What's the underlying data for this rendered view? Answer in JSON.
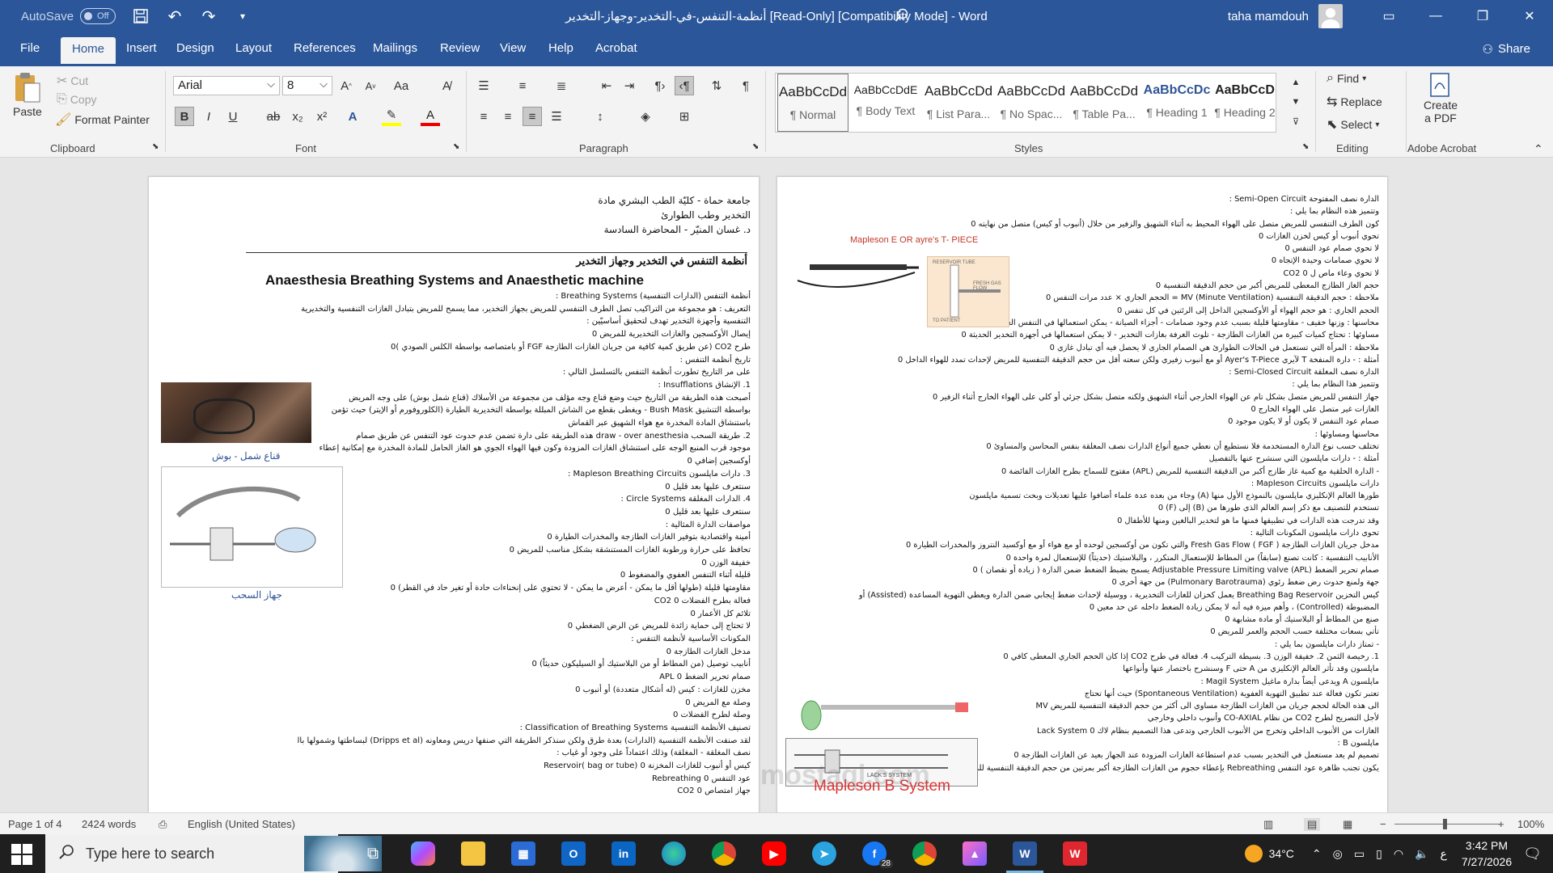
{
  "titlebar": {
    "autosave_label": "AutoSave",
    "autosave_state": "Off",
    "doc_title": "أنظمة-التنفس-في-التخدير-وجهاز-التخدير [Read-Only] [Compatibility Mode]  -  Word",
    "username": "taha mamdouh"
  },
  "tabs": [
    "File",
    "Home",
    "Insert",
    "Design",
    "Layout",
    "References",
    "Mailings",
    "Review",
    "View",
    "Help",
    "Acrobat"
  ],
  "share_label": "Share",
  "clipboard": {
    "paste": "Paste",
    "cut": "Cut",
    "copy": "Copy",
    "format_painter": "Format Painter",
    "group": "Clipboard"
  },
  "font": {
    "name": "Arial",
    "size": "8",
    "group": "Font"
  },
  "paragraph": {
    "group": "Paragraph"
  },
  "styles": {
    "group": "Styles",
    "items": [
      {
        "sample": "AaBbCcDd",
        "name": "¶ Normal"
      },
      {
        "sample": "AaBbCcDdE",
        "name": "¶ Body Text"
      },
      {
        "sample": "AaBbCcDd",
        "name": "¶ List Para..."
      },
      {
        "sample": "AaBbCcDd",
        "name": "¶ No Spac..."
      },
      {
        "sample": "AaBbCcDd",
        "name": "¶ Table Pa..."
      },
      {
        "sample": "AaBbCcDc",
        "name": "¶ Heading 1"
      },
      {
        "sample": "AaBbCcD",
        "name": "¶ Heading 2"
      }
    ]
  },
  "editing": {
    "group": "Editing",
    "find": "Find",
    "replace": "Replace",
    "select": "Select"
  },
  "acrobat": {
    "group": "Adobe Acrobat",
    "create": "Create",
    "pdf": "a PDF"
  },
  "left_page": {
    "header_lines": [
      "جامعة حماة - كليّة الطب البشري مادة",
      "التخدير وطب الطوارئ",
      "د. غسان المنيّر - المحاضرة السادسة"
    ],
    "title_ar": "أنظمة التنفس في التخدير وجهاز التخدير",
    "title_en": "Anaesthesia Breathing Systems and Anaesthetic machine",
    "body": [
      "أنظمة التنفس (الدارات التنفسية) Breathing Systems :",
      "التعريف : هو مجموعة من التراكيب تصل الطرف التنفسي للمريض بجهاز التخدير، مما يسمح للمريض بتبادل الغازات التنفسية والتخديرية من والى جهاز التخدير الهدف : جميع أنواع الدارات",
      "التنفسية وأجهزة التخدير تهدف لتحقيق أساسيّين :",
      "إيصال الأوكسجين والغازات التخديرية للمريض 0",
      "طرح CO2 (عن طريق كمية كافية من جريان الغازات الطازجة FGF أو بامتصاصه بواسطة الكلس الصودي )0",
      "تاريخ أنظمة التنفس :",
      "على مر التاريخ تطورت أنظمة التنفس بالتسلسل التالي :",
      "1. الإنشاق Insufflations :",
      "أصبحت هذه الطريقة من التاريخ حيث وضع قناع وجه مؤلف من مجموعة من الأسلاك (قناع شمل بوش) على وجه المريض",
      "بواسطة التنشيق Bush Mask - ويغطى بقطع من الشاش المبللة بواسطة التخديرية الطيارة (الكلوروفورم أو الإيتر) حيث تؤمن",
      "باستنشاق المادة المخدرة مع هواء الشهيق عبر القماش",
      "2. طريقة السحب draw - over anesthesia هذه الطريقة على دارة تضمن عدم حدوث عود التنفس عن طريق صمام",
      "موجود قرب المنبع الوجه على استنشاق الغازات المزودة وكون فيها الهواء الجوي هو الغاز الحامل للمادة المخدرة مع إمكانية إعطاء",
      "أوكسجين إضافي 0",
      "3. دارات ماپلسون Mapleson Breathing Circuits :",
      "سنتعرف عليها بعد قليل 0",
      "4. الدارات المغلقة Circle Systems :",
      "سنتعرف عليها بعد قليل 0",
      "مواصفات الدارة المثالية :",
      "أمينة واقتصادية بتوفير الغازات الطازجة والمخدرات الطيارة 0",
      "تحافظ على حرارة ورطوبة الغازات المستنشقة بشكل مناسب للمريض 0",
      "خفيفة الوزن 0",
      "قليلة أثناء التنفس العفوي والمضغوط 0",
      "مقاومتها قليلة (طولها أقل ما يمكن - أعرض ما يمكن - لا تحتوي على إنحناءات حادة أو تغير حاد في القطر) 0",
      "فعالة بطرح الفضلات CO2 0",
      "تلائم كل الأعمار 0",
      "لا تحتاج إلى حماية زائدة للمريض عن الرض الضغطي 0",
      "المكونات الأساسية لأنظمة التنفس :",
      "مدخل الغازات الطازجة 0",
      "أنابيب توصيل (من المطاط أو من البلاستيك أو السيليكون حديثاً) 0",
      "صمام تحرير الضغط APL 0",
      "مخزن للغازات : كيس (له أشكال متعددة) أو أنبوب 0",
      "وصلة مع المريض 0",
      "وصلة لطرح الفضلات 0",
      "تصنيف الأنظمة التنفسية Classification of Breathing Systems :",
      "لقد صنفت الأنظمة التنفسية (الدارات) بعدة طرق ولكن سنذكر الطريقة التي صنفها دريس ومعاونه (Dripps et al) لبساطتها وشمولها بالشكل التالي : (المفتوحة - نصف المفتوحة -",
      "نصف المغلقة - المغلقة) وذلك اعتماداً على وجود أو غياب :",
      "كيس أو أنبوب للغازات المخزنة Reservoir( bag or tube) 0",
      "عود التنفس Rebreathing 0",
      "جهاز امتصاص CO2 0"
    ],
    "caption_mask": "قناع شمل - بوش",
    "caption_draw": "جهاز السحب"
  },
  "right_page": {
    "body": [
      "الدارة نصف المفتوحة Semi-Open Circuit :",
      "وتتميز هذه النظام بما يلي :",
      "كون الطرف التنفسي للمريض متصل على الهواء المحيط به أثناء الشهيق والزفير من خلال (أنبوب أو كيس) متصل من نهايته 0",
      "تحوي أنبوب أو كيس لخزن الغازات 0",
      "لا تحوي صمام عود التنفس 0",
      "لا تحوي صمامات وحيدة الإتجاه 0",
      "لا تحوي وعاء ماص ل CO2 0",
      "حجم الغاز الطازج المعطى للمريض أكبر من حجم الدقيقة التنفسية 0",
      "ملاحظة : حجم الدقيقة التنفسية MV (Minute Ventilation) = الحجم الجاري × عدد مرات التنفس 0",
      "الحجم الجاري : هو حجم الهواء أو الأوكسجين الداخل إلى الرئتين في كل تنفس 0",
      "محاسنها : وزنها خفيف - مقاومتها قليلة بسبب عدم وجود صمامات - أجزاء الصيانة - يمكن استعمالها في التنفس العفوي والمضغوط 0",
      "مساوئها : تحتاج كميات كبيرة من الغازات الطازجة - تلوث الغرفة بغازات التخدير - لا يمكن استعمالها في أجهزة التخدير الحديثة 0",
      "ملاحظة : المرأة التي تستعمل في الحالات الطوارئ هي الصمام الجاري لا يحصل فيه أي تبادل غازي 0",
      "أمثلة : - دارة المنفخة T لآيري Ayer's T-Piece أو مع أنبوب زفيري ولكن سعته أقل من حجم الدقيقة التنفسية للمريض لإحداث تمدد للهواء الداخل 0",
      "الدارة نصف المغلقة Semi-Closed Circuit :",
      "وتتميز هذا النظام بما يلي :",
      "جهاز التنفس للمريض متصل بشكل تام عن الهواء الخارجي أثناء الشهيق ولكنه متصل بشكل جزئي أو كلي على الهواء الخارج أثناء الزفير 0",
      "الغازات غير متصل على الهواء الخارج 0",
      "صمام عود التنفس لا يكون أو لا يكون موجود 0",
      "محاسنها ومساوئها :",
      "تختلف حسب نوع الدارة المستخدمة فلا نستطيع أن نعطي جميع أنواع الدارات نصف المغلقة بنفس المحاسن والمساوئ 0",
      "أمثلة : - دارات ماپلسون التي سنشرح عنها بالتفصيل",
      "- الدارة الحلقية مع كمية غاز طازج أكبر من الدقيقة التنفسية للمريض (APL) مفتوح للسماح بطرح الغازات الفائضة 0",
      "دارات ماپلسون Mapleson Circuits :",
      "طورها العالم الإنكليزي ماپلسون بالنموذج الأول منها (A) وجاء من بعده عدة علماء أضافوا عليها تعديلات وبحث تسمية ماپلسون",
      "تستخدم للتصنيف مع ذكر إسم العالم الذي طورها من (B) إلى (F) 0",
      "وقد تدرجت هذه الدارات في تطبيقها فمنها ما هو لتخدير البالغين ومنها للأطفال 0",
      "تحوي دارات ماپلسون المكونات التالية :",
      "مدخل جريان الغازات الطازجة Fresh Gas Flow ( FGF ) والتي تكون من أوكسجين لوحده أو مع هواء أو مع أوكسيد النتروز والمخدرات الطيارة 0",
      "الأنابيب التنفسية : كانت تصنع (سابقاً) من المطاط للإستعمال المتكرر ، والبلاستيك (حديثاً) للإستعمال لمرة واحدة 0",
      "صمام تحرير الضغط Adjustable Pressure Limiting valve (APL) يسمح بضبط الضغط ضمن الدارة ( زيادة أو نقصان ) 0",
      "جهة ولمنع حدوث رض ضغط رئوي (Pulmonary Barotrauma) من جهة أخرى 0",
      "كيس التخزين Breathing Bag Reservoir يعمل كخزان للغازات التخديرية ، ووسيلة لإحداث ضغط إيجابي ضمن الدارة ويعطي التهوية المساعدة (Assisted) أو",
      "المضبوطة (Controlled) ، وأهم ميزة فيه أنه لا يمكن زيادة الضغط داخله عن حد معين 0",
      "صنع من المطاط أو البلاستيك أو مادة مشابهة 0",
      "تأتي بسعات مختلفة حسب الحجم والعمر للمريض 0",
      "- تمتاز دارات ماپلسون بما يلي :",
      "1. رخيصة الثمن 2. خفيفة الوزن 3. بسيطة التركيب 4. فعالة في طرح CO2 إذا كان الحجم الجاري المعطى كافي 0",
      "ماپلسون وقد تأثر العالم الإنكليزي من A حتى F وسنشرح باختصار عنها وأنواعها",
      "ماپلسون A ويدعى أيضاً بدارة ماغيل Magil System :",
      "تعتبر تكون فعالة عند تطبيق التهوية العفوية (Spontaneous Ventilation) حيث أنها تحتاج",
      "الى هذه الحالة لحجم جريان من الغازات الطازجة مساوي الى أكثر من حجم الدقيقة التنفسية للمريض MV",
      "لأجل التصريح لطرح CO2 من نظام CO-AXIAL وأنبوب داخلي وخارجي",
      "الغازات من الأنبوب الداخلي وتخرج من الأنبوب الخارجي وتدعى هذا التصميم بنظام لاك Lack System 0",
      "ماپلسون B :",
      "تصميم لم يعد مستعمل في التخدير بسبب عدم استطاعة الغازات المزودة عند الجهاز بعيد عن الغازات الطازجة 0",
      "يكون تجنب ظاهرة عود التنفس Rebreathing بإعطاء حجوم من الغازات الطازجة أكبر بمرتين من حجم الدقيقة التنفسية للمريض 0"
    ],
    "label_tpiece": "Mapleson E OR ayre's T- PIECE",
    "label_bsystem": "Mapleson B System",
    "label_reservoir_tube": "RESERVOIR TUBE",
    "label_fresh_gas": "FRESH GAS FLOW",
    "label_to_patient": "TO PATIENT",
    "label_lack": "LACK'S SYSTEM"
  },
  "watermark": "mostaql.com",
  "statusbar": {
    "page": "Page 1 of 4",
    "words": "2424 words",
    "language": "English (United States)",
    "zoom": "100%"
  },
  "taskbar": {
    "search_placeholder": "Type here to search",
    "temperature": "34°C",
    "time": "3:42 PM",
    "date": "7/27/2026",
    "notif_count": "4",
    "facebook_badge": "28",
    "lang": "ع"
  }
}
